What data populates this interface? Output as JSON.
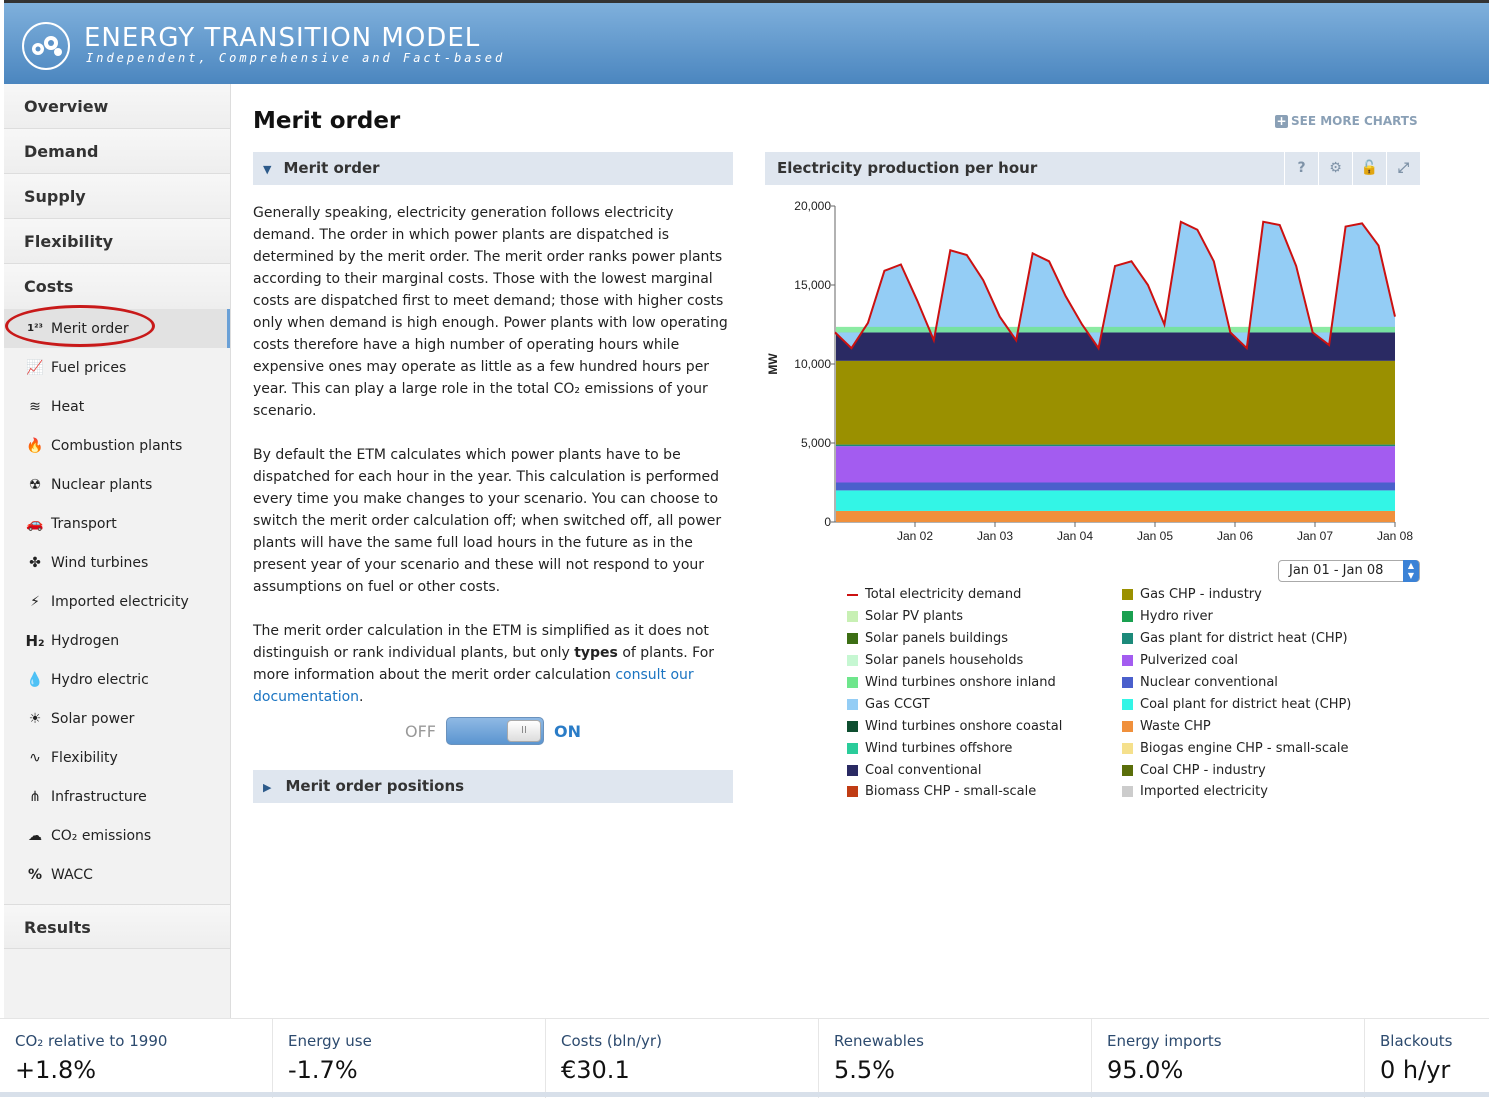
{
  "brand": {
    "title": "ENERGY TRANSITION MODEL",
    "subtitle": "Independent, Comprehensive and Fact-based"
  },
  "sidebar": {
    "sections_top": [
      "Overview",
      "Demand",
      "Supply",
      "Flexibility",
      "Costs"
    ],
    "items": [
      {
        "label": "Merit order",
        "icon": "merit-order-icon"
      },
      {
        "label": "Fuel prices",
        "icon": "line-chart-icon"
      },
      {
        "label": "Heat",
        "icon": "heat-waves-icon"
      },
      {
        "label": "Combustion plants",
        "icon": "flame-icon"
      },
      {
        "label": "Nuclear plants",
        "icon": "radiation-icon"
      },
      {
        "label": "Transport",
        "icon": "car-icon"
      },
      {
        "label": "Wind turbines",
        "icon": "wind-turbine-icon"
      },
      {
        "label": "Imported electricity",
        "icon": "lightning-icon"
      },
      {
        "label": "Hydrogen",
        "icon": "hydrogen-icon"
      },
      {
        "label": "Hydro electric",
        "icon": "water-drop-icon"
      },
      {
        "label": "Solar power",
        "icon": "sun-icon"
      },
      {
        "label": "Flexibility",
        "icon": "wave-icon"
      },
      {
        "label": "Infrastructure",
        "icon": "pylon-icon"
      },
      {
        "label": "CO₂ emissions",
        "icon": "cloud-icon"
      },
      {
        "label": "WACC",
        "icon": "percent-icon"
      }
    ],
    "sections_bottom": [
      "Results"
    ]
  },
  "main": {
    "title": "Merit order",
    "see_more": "SEE MORE CHARTS",
    "panel_title": "Merit order",
    "desc_p1": "Generally speaking, electricity generation follows electricity demand. The order in which power plants are dispatched is determined by the merit order. The merit order ranks power plants according to their marginal costs. Those with the lowest marginal costs are dispatched first to meet demand; those with higher costs only when demand is high enough. Power plants with low operating costs therefore have a high number of operating hours while expensive ones may operate as little as a few hundred hours per year. This can play a large role in the total CO₂ emissions of your scenario.",
    "desc_p2": "By default the ETM calculates which power plants have to be dispatched for each hour in the year. This calculation is performed every time you make changes to your scenario. You can choose to switch the merit order calculation off; when switched off, all power plants will have the same full load hours in the future as in the present year of your scenario and these will not respond to your assumptions on fuel or other costs.",
    "desc_p3_a": "The merit order calculation in the ETM is simplified as it does not distinguish or rank individual plants, but only ",
    "desc_p3_b": "types",
    "desc_p3_c": " of plants. For more information about the merit order calculation ",
    "desc_p3_link": "consult our documentation",
    "desc_p3_d": ".",
    "switch_off": "OFF",
    "switch_on": "ON",
    "switch_knob": "II",
    "positions_title": "Merit order positions"
  },
  "chart_panel": {
    "title": "Electricity production per hour",
    "date_range": "Jan 01 - Jan 08"
  },
  "chart_data": {
    "type": "area",
    "ylabel": "MW",
    "ylim": [
      0,
      20000
    ],
    "yticks": [
      "0",
      "5,000",
      "10,000",
      "15,000",
      "20,000"
    ],
    "xticks": [
      "Jan 02",
      "Jan 03",
      "Jan 04",
      "Jan 05",
      "Jan 06",
      "Jan 07",
      "Jan 08"
    ],
    "stack_bases": [
      {
        "name": "Waste CHP",
        "color": "#f0903c",
        "value": 700
      },
      {
        "name": "Coal plant for district heat (CHP)",
        "color": "#33f5e6",
        "value": 1300
      },
      {
        "name": "Nuclear conventional",
        "color": "#4a5fcc",
        "value": 500
      },
      {
        "name": "Pulverized coal",
        "color": "#a35cf0",
        "value": 2300
      },
      {
        "name": "Gas plant for district heat (CHP)",
        "color": "#1c8a7a",
        "value": 100
      },
      {
        "name": "Gas CHP - industry",
        "color": "#9a9000",
        "value": 5300
      },
      {
        "name": "Coal conventional",
        "color": "#2a2a63",
        "value": 1800
      }
    ],
    "demand_series": [
      12000,
      11000,
      12600,
      15900,
      16300,
      14000,
      11500,
      17200,
      16900,
      15300,
      13000,
      11500,
      17000,
      16500,
      14300,
      12500,
      11000,
      16200,
      16500,
      15000,
      12500,
      19000,
      18500,
      16500,
      12000,
      11000,
      19000,
      18800,
      16200,
      12000,
      11200,
      18700,
      18900,
      17500,
      13000
    ],
    "legend": [
      {
        "name": "Total electricity demand",
        "color": "#cc1111",
        "kind": "line"
      },
      {
        "name": "Solar PV plants",
        "color": "#c8f0b4"
      },
      {
        "name": "Solar panels buildings",
        "color": "#3c6e14"
      },
      {
        "name": "Solar panels households",
        "color": "#c6f7d2"
      },
      {
        "name": "Wind turbines onshore inland",
        "color": "#6ee68c"
      },
      {
        "name": "Gas CCGT",
        "color": "#94cdf5"
      },
      {
        "name": "Wind turbines onshore coastal",
        "color": "#0e4e30"
      },
      {
        "name": "Wind turbines offshore",
        "color": "#2acc9a"
      },
      {
        "name": "Coal conventional",
        "color": "#2a2a63"
      },
      {
        "name": "Biomass CHP - small-scale",
        "color": "#c03c14"
      },
      {
        "name": "Gas CHP - industry",
        "color": "#9a9000"
      },
      {
        "name": "Hydro river",
        "color": "#1aa050"
      },
      {
        "name": "Gas plant for district heat (CHP)",
        "color": "#1c8a7a"
      },
      {
        "name": "Pulverized coal",
        "color": "#a35cf0"
      },
      {
        "name": "Nuclear conventional",
        "color": "#4a5fcc"
      },
      {
        "name": "Coal plant for district heat (CHP)",
        "color": "#33f5e6"
      },
      {
        "name": "Waste CHP",
        "color": "#f0903c"
      },
      {
        "name": "Biogas engine CHP - small-scale",
        "color": "#f5e08c"
      },
      {
        "name": "Coal CHP - industry",
        "color": "#5a6e0a"
      },
      {
        "name": "Imported electricity",
        "color": "#cccccc"
      }
    ]
  },
  "footer": [
    {
      "label": "CO₂ relative to 1990",
      "value": "+1.8%"
    },
    {
      "label": "Energy use",
      "value": "-1.7%"
    },
    {
      "label": "Costs (bln/yr)",
      "value": "€30.1"
    },
    {
      "label": "Renewables",
      "value": "5.5%"
    },
    {
      "label": "Energy imports",
      "value": "95.0%"
    },
    {
      "label": "Blackouts",
      "value": "0 h/yr"
    }
  ]
}
